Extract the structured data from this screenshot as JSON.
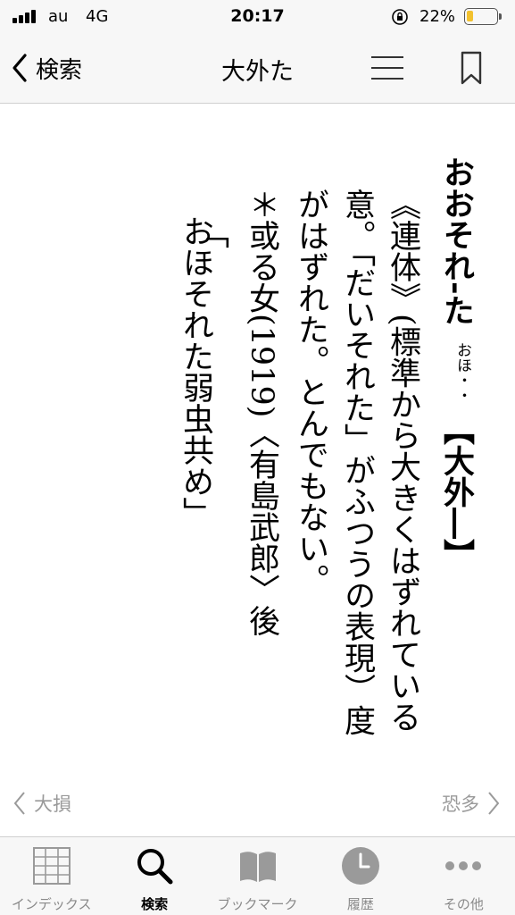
{
  "status_bar": {
    "carrier": "au",
    "network": "4G",
    "time": "20:17",
    "battery_percent": "22%",
    "battery_level": 0.22
  },
  "nav": {
    "back_label": "検索",
    "title": "大外た",
    "menu_icon": "list-icon",
    "bookmark_icon": "bookmark-icon"
  },
  "entry": {
    "headword": "おおそれ‐た",
    "reading": "おほ・・",
    "kanji": "【大外―】",
    "lines": [
      "《連体》(標準から大きくはずれている",
      "意。「だいそれた」がふつうの表現）度",
      "がはずれた。とんでもない。",
      "＊或る女(1919)〈有島武郎〉後",
      "「",
      "おほそれた弱虫共め」"
    ]
  },
  "pager": {
    "prev_label": "大損",
    "next_label": "恐多"
  },
  "tabs": [
    {
      "label": "インデックス",
      "icon": "grid-icon"
    },
    {
      "label": "検索",
      "icon": "search-icon"
    },
    {
      "label": "ブックマーク",
      "icon": "book-icon"
    },
    {
      "label": "履歴",
      "icon": "clock-icon"
    },
    {
      "label": "その他",
      "icon": "more-icon"
    }
  ],
  "colors": {
    "bar_background": "#f7f7f7",
    "inactive": "#9a9a9a",
    "battery": "#f2c12e"
  }
}
